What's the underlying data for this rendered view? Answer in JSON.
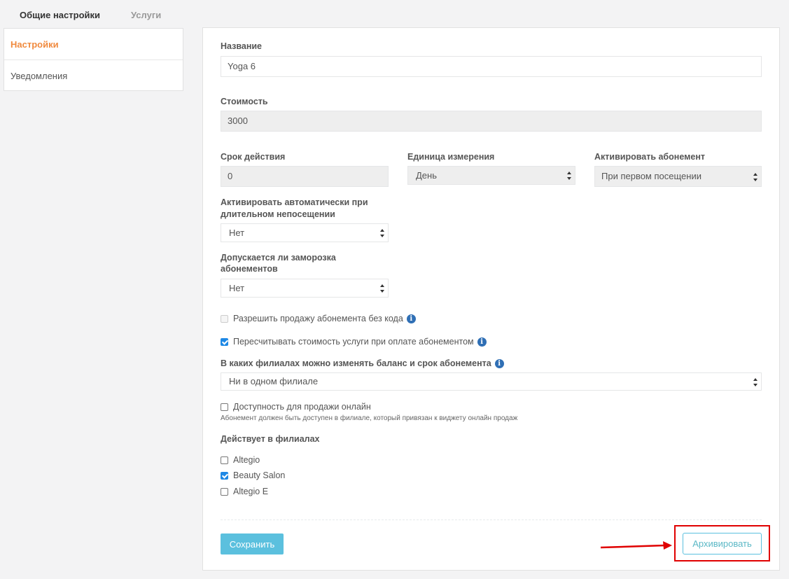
{
  "top_tabs": {
    "general": "Общие настройки",
    "services": "Услуги"
  },
  "sidebar": {
    "items": [
      {
        "label": "Настройки"
      },
      {
        "label": "Уведомления"
      }
    ]
  },
  "form": {
    "name_label": "Название",
    "name_value": "Yoga 6",
    "cost_label": "Стоимость",
    "cost_value": "3000",
    "validity_label": "Срок действия",
    "validity_value": "0",
    "unit_label": "Единица измерения",
    "unit_value": "День",
    "activate_label": "Активировать абонемент",
    "activate_value": "При первом посещении",
    "auto_activate_label_line1": "Активировать автоматически при",
    "auto_activate_label_line2": "длительном непосещении",
    "auto_activate_value": "Нет",
    "freeze_label_line1": "Допускается ли заморозка",
    "freeze_label_line2": "абонементов",
    "freeze_value": "Нет",
    "allow_sale_without_code": "Разрешить продажу абонемента без кода",
    "recalc_cost": "Пересчитывать стоимость услуги при оплате абонементом",
    "branches_balance_label": "В каких филиалах можно изменять баланс и срок абонемента",
    "branches_balance_value": "Ни в одном филиале",
    "online_sale": "Доступность для продажи онлайн",
    "online_sale_note": "Абонемент должен быть доступен в филиале, который привязан к виджету онлайн продаж",
    "branches_label": "Действует в филиалах",
    "branches": [
      {
        "label": "Altegio",
        "checked": false
      },
      {
        "label": "Beauty Salon",
        "checked": true
      },
      {
        "label": "Altegio E",
        "checked": false
      }
    ],
    "info_icon_glyph": "i"
  },
  "actions": {
    "save": "Сохранить",
    "archive": "Архивировать"
  },
  "colors": {
    "accent": "#f08a3e",
    "save": "#5bc0de",
    "highlight": "#e00000",
    "checkbox": "#1e88e5"
  }
}
